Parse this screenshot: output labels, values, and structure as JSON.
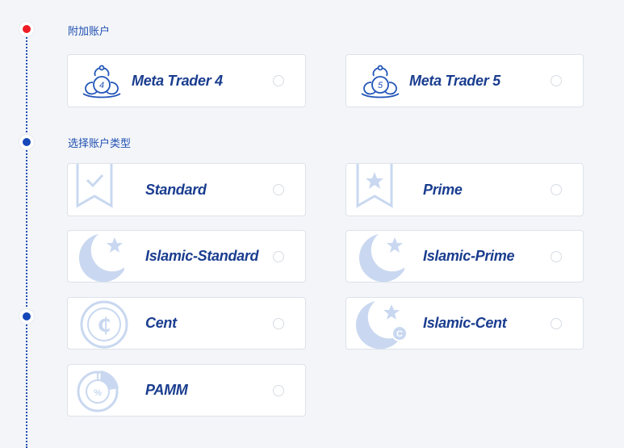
{
  "steps": [
    {
      "title": "附加账户",
      "dot_color": "#ee1c25"
    },
    {
      "title": "选择账户类型",
      "dot_color": "#1547b8"
    },
    {
      "title": "",
      "dot_color": "#1547b8"
    }
  ],
  "platforms": [
    {
      "label": "Meta Trader 4",
      "badge": "4"
    },
    {
      "label": "Meta Trader 5",
      "badge": "5"
    }
  ],
  "account_types": [
    {
      "label": "Standard"
    },
    {
      "label": "Prime"
    },
    {
      "label": "Islamic-Standard"
    },
    {
      "label": "Islamic-Prime"
    },
    {
      "label": "Cent",
      "symbol": "₵"
    },
    {
      "label": "Islamic-Cent",
      "symbol": "C"
    },
    {
      "label": "PAMM",
      "symbol": "%"
    }
  ],
  "colors": {
    "accent": "#1a3d8f",
    "icon_light": "#c9d8f0",
    "icon_dark": "#2356b8"
  }
}
